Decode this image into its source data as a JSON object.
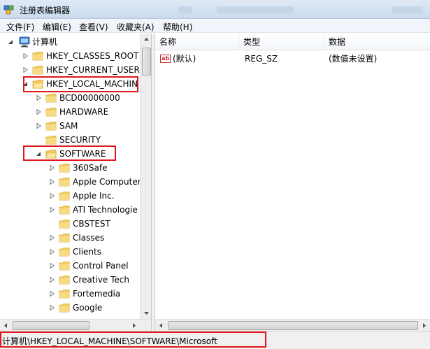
{
  "window": {
    "title": "注册表编辑器"
  },
  "menu": [
    "文件(F)",
    "编辑(E)",
    "查看(V)",
    "收藏夹(A)",
    "帮助(H)"
  ],
  "tree": {
    "root": "计算机",
    "hives": [
      {
        "label": "HKEY_CLASSES_ROOT"
      },
      {
        "label": "HKEY_CURRENT_USER"
      },
      {
        "label": "HKEY_LOCAL_MACHIN"
      }
    ],
    "hklm_children": [
      {
        "label": "BCD00000000",
        "has_children": true
      },
      {
        "label": "HARDWARE",
        "has_children": true
      },
      {
        "label": "SAM",
        "has_children": true
      },
      {
        "label": "SECURITY",
        "has_children": false
      },
      {
        "label": "SOFTWARE",
        "has_children": true,
        "expanded": true
      }
    ],
    "software_children": [
      {
        "label": "360Safe",
        "has_children": true
      },
      {
        "label": "Apple Computer",
        "has_children": true
      },
      {
        "label": "Apple Inc.",
        "has_children": true
      },
      {
        "label": "ATI Technologie",
        "has_children": true
      },
      {
        "label": "CBSTEST",
        "has_children": false
      },
      {
        "label": "Classes",
        "has_children": true
      },
      {
        "label": "Clients",
        "has_children": true
      },
      {
        "label": "Control Panel",
        "has_children": true
      },
      {
        "label": "Creative Tech",
        "has_children": true
      },
      {
        "label": "Fortemedia",
        "has_children": true
      },
      {
        "label": "Google",
        "has_children": true
      }
    ]
  },
  "values": {
    "columns": [
      "名称",
      "类型",
      "数据"
    ],
    "rows": [
      {
        "icon": "ab",
        "name": "(默认)",
        "type": "REG_SZ",
        "data": "(数值未设置)"
      }
    ]
  },
  "statusbar": {
    "path": "计算机\\HKEY_LOCAL_MACHINE\\SOFTWARE\\Microsoft"
  },
  "colors": {
    "highlight": "#e0181e",
    "folder": "#f2cc5c",
    "folder_dark": "#d9a72e"
  }
}
